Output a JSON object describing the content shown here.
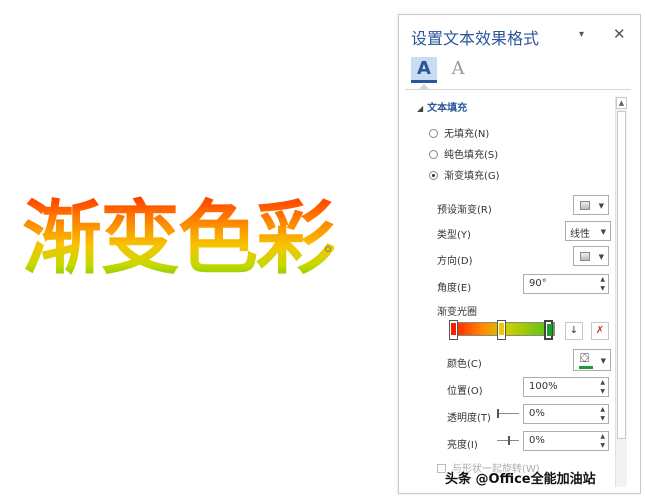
{
  "document": {
    "text": "渐变色彩",
    "gradient_colors": [
      "#ff2a00",
      "#ff7e00",
      "#f7c400",
      "#c6d900",
      "#5cc21a"
    ]
  },
  "pane": {
    "title": "设置文本效果格式",
    "menu_glyph": "▾",
    "close_glyph": "✕",
    "tab_fill_glyph": "A",
    "tab_effects_glyph": "A",
    "accent": "#2b579a",
    "section_fill": {
      "header_glyph": "◢",
      "header": "文本填充",
      "options": [
        {
          "label": "无填充(N)",
          "selected": false
        },
        {
          "label": "纯色填充(S)",
          "selected": false
        },
        {
          "label": "渐变填充(G)",
          "selected": true
        }
      ],
      "preset_label": "预设渐变(R)",
      "type_label": "类型(Y)",
      "type_value": "线性",
      "direction_label": "方向(D)",
      "angle_label": "角度(E)",
      "angle_value": "90°",
      "stops_label": "渐变光圈",
      "stops": [
        {
          "position": 0,
          "color": "#ff1a00",
          "selected": false
        },
        {
          "position": 50,
          "color": "#f7c400",
          "selected": false
        },
        {
          "position": 100,
          "color": "#1f9b3a",
          "selected": true
        }
      ],
      "add_stop_glyph": "↓",
      "remove_stop_glyph": "✗",
      "color_label": "颜色(C)",
      "color_value": "#1f9b3a",
      "bucket_glyph": "⛋",
      "position_label": "位置(O)",
      "position_value": "100%",
      "transparency_label": "透明度(T)",
      "transparency_value": "0%",
      "brightness_label": "亮度(I)",
      "brightness_value": "0%",
      "rotate_label": "与形状一起旋转(W)"
    }
  },
  "watermark": "头条 @Office全能加油站"
}
